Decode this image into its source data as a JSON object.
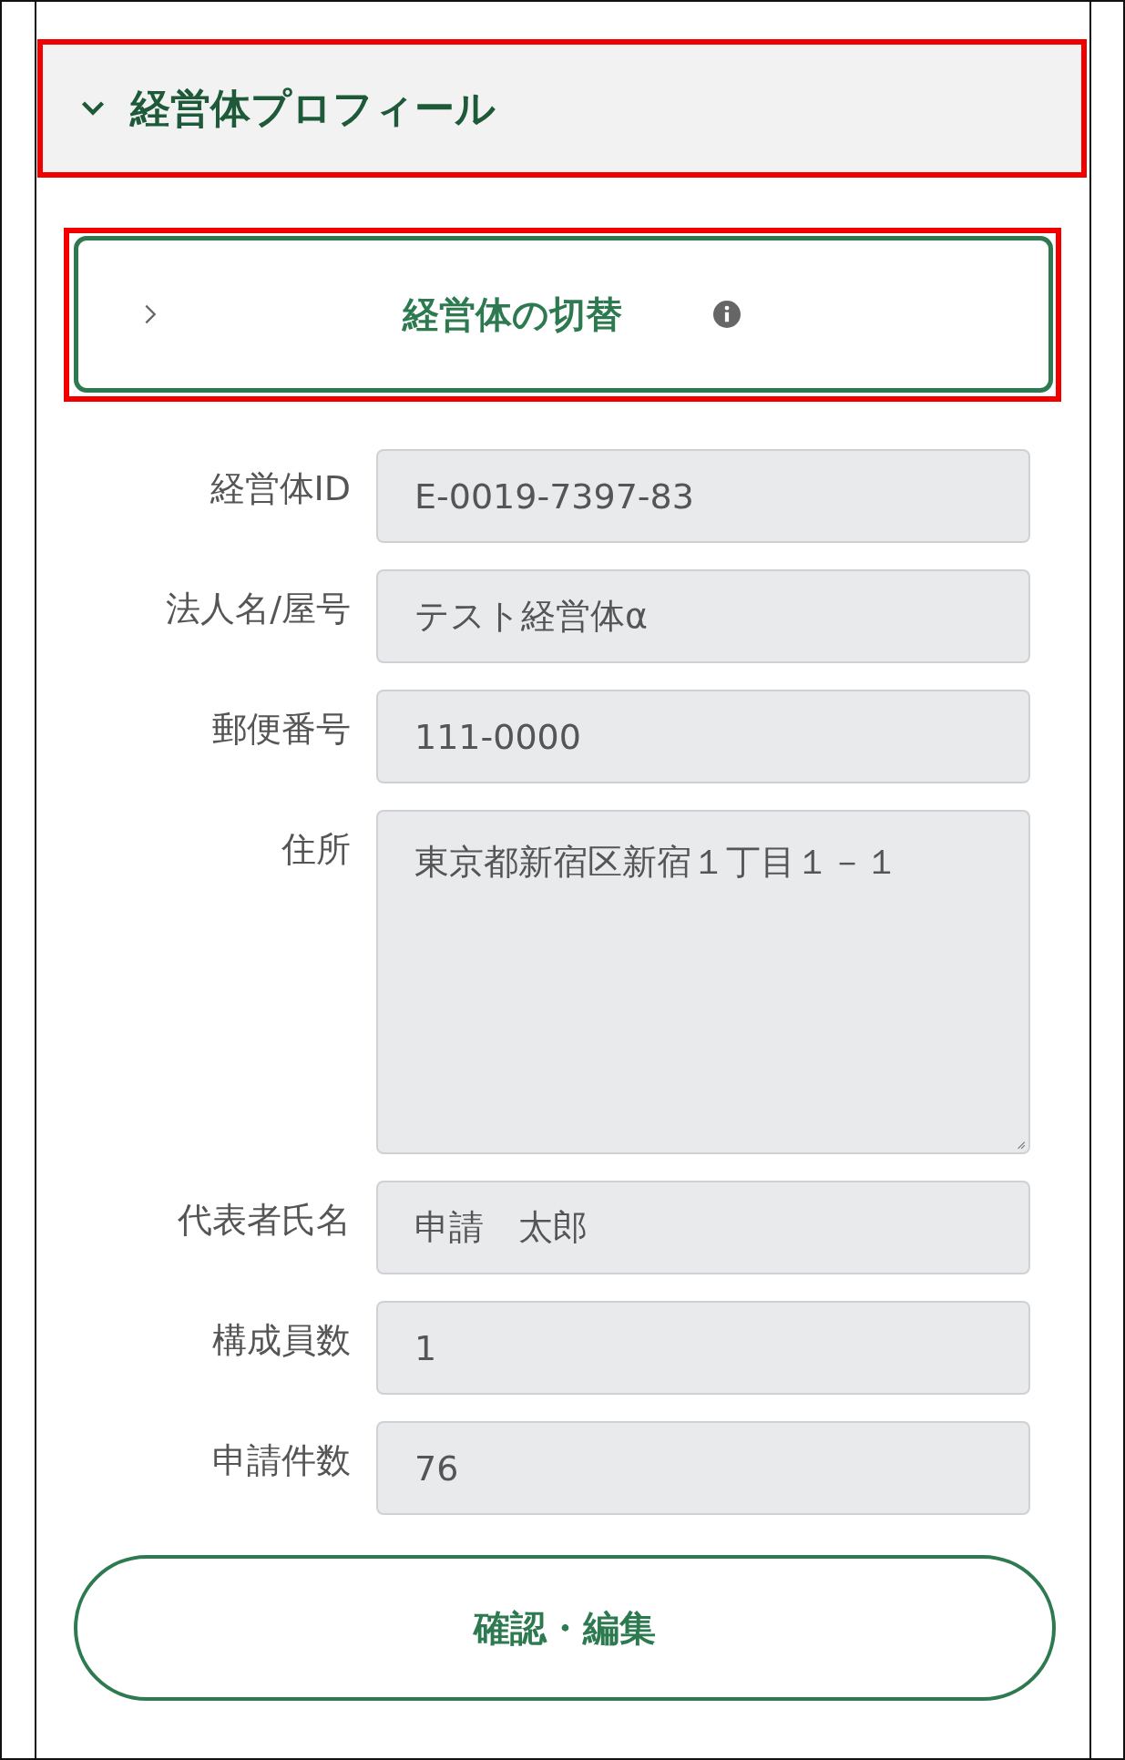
{
  "section": {
    "title": "経営体プロフィール",
    "expanded": true,
    "highlighted": true
  },
  "switch_button": {
    "label": "経営体の切替",
    "highlighted": true
  },
  "fields": [
    {
      "label": "経営体ID",
      "value": "E-0019-7397-83",
      "kind": "input"
    },
    {
      "label": "法人名/屋号",
      "value": "テスト経営体α",
      "kind": "input"
    },
    {
      "label": "郵便番号",
      "value": "111-0000",
      "kind": "input"
    },
    {
      "label": "住所",
      "value": "東京都新宿区新宿１丁目１－１",
      "kind": "textarea"
    },
    {
      "label": "代表者氏名",
      "value": "申請　太郎",
      "kind": "input"
    },
    {
      "label": "構成員数",
      "value": "1",
      "kind": "input"
    },
    {
      "label": "申請件数",
      "value": "76",
      "kind": "input"
    }
  ],
  "edit_button": {
    "label": "確認・編集"
  }
}
